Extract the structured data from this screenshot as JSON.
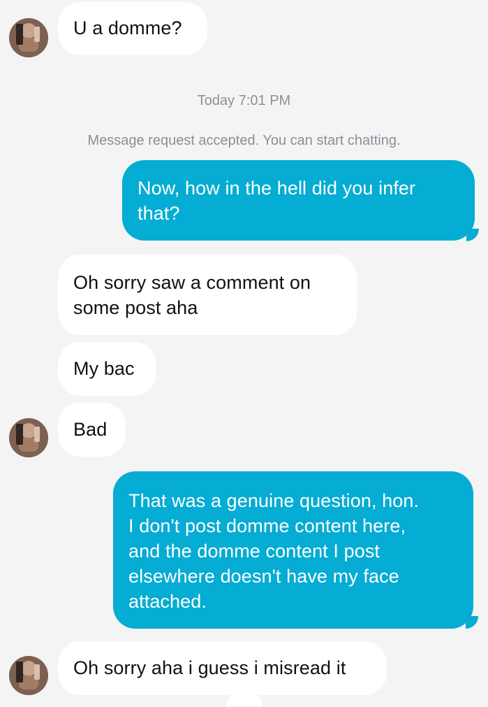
{
  "conversation": {
    "timestamp": "Today 7:01 PM",
    "status_message": "Message request accepted. You can start chatting.",
    "messages": [
      {
        "direction": "incoming",
        "text": "U a domme?"
      },
      {
        "direction": "outgoing",
        "lines": [
          "Now, how in the hell did you infer",
          "that?"
        ]
      },
      {
        "direction": "incoming",
        "lines": [
          "Oh sorry saw a comment on",
          "some post aha"
        ]
      },
      {
        "direction": "incoming",
        "text": "My bac"
      },
      {
        "direction": "incoming",
        "text": "Bad"
      },
      {
        "direction": "outgoing",
        "lines": [
          "That was a genuine question, hon.",
          "I don't post domme content here,",
          "and the domme content I post",
          "elsewhere doesn't have my face",
          "attached."
        ]
      },
      {
        "direction": "incoming",
        "text": "Oh sorry aha i guess i misread it"
      }
    ]
  },
  "colors": {
    "background": "#f4f4f5",
    "incoming_bubble": "#ffffff",
    "outgoing_bubble": "#05acd3",
    "meta_text": "#8a8f97"
  },
  "icons": {
    "avatar": "avatar-photo-icon"
  }
}
